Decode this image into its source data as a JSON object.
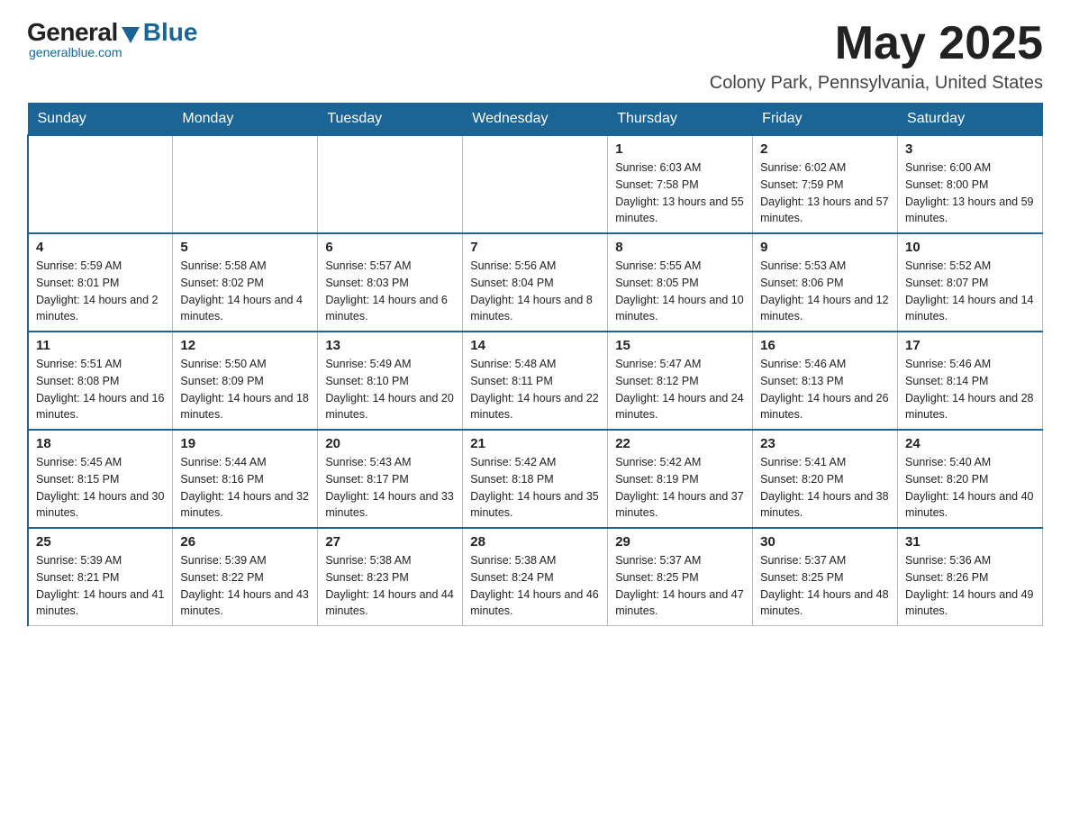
{
  "header": {
    "logo": {
      "general": "General",
      "blue": "Blue",
      "subtitle": "generalblue.com"
    },
    "title": "May 2025",
    "location": "Colony Park, Pennsylvania, United States"
  },
  "days_of_week": [
    "Sunday",
    "Monday",
    "Tuesday",
    "Wednesday",
    "Thursday",
    "Friday",
    "Saturday"
  ],
  "weeks": [
    [
      {
        "day": "",
        "info": ""
      },
      {
        "day": "",
        "info": ""
      },
      {
        "day": "",
        "info": ""
      },
      {
        "day": "",
        "info": ""
      },
      {
        "day": "1",
        "info": "Sunrise: 6:03 AM\nSunset: 7:58 PM\nDaylight: 13 hours and 55 minutes."
      },
      {
        "day": "2",
        "info": "Sunrise: 6:02 AM\nSunset: 7:59 PM\nDaylight: 13 hours and 57 minutes."
      },
      {
        "day": "3",
        "info": "Sunrise: 6:00 AM\nSunset: 8:00 PM\nDaylight: 13 hours and 59 minutes."
      }
    ],
    [
      {
        "day": "4",
        "info": "Sunrise: 5:59 AM\nSunset: 8:01 PM\nDaylight: 14 hours and 2 minutes."
      },
      {
        "day": "5",
        "info": "Sunrise: 5:58 AM\nSunset: 8:02 PM\nDaylight: 14 hours and 4 minutes."
      },
      {
        "day": "6",
        "info": "Sunrise: 5:57 AM\nSunset: 8:03 PM\nDaylight: 14 hours and 6 minutes."
      },
      {
        "day": "7",
        "info": "Sunrise: 5:56 AM\nSunset: 8:04 PM\nDaylight: 14 hours and 8 minutes."
      },
      {
        "day": "8",
        "info": "Sunrise: 5:55 AM\nSunset: 8:05 PM\nDaylight: 14 hours and 10 minutes."
      },
      {
        "day": "9",
        "info": "Sunrise: 5:53 AM\nSunset: 8:06 PM\nDaylight: 14 hours and 12 minutes."
      },
      {
        "day": "10",
        "info": "Sunrise: 5:52 AM\nSunset: 8:07 PM\nDaylight: 14 hours and 14 minutes."
      }
    ],
    [
      {
        "day": "11",
        "info": "Sunrise: 5:51 AM\nSunset: 8:08 PM\nDaylight: 14 hours and 16 minutes."
      },
      {
        "day": "12",
        "info": "Sunrise: 5:50 AM\nSunset: 8:09 PM\nDaylight: 14 hours and 18 minutes."
      },
      {
        "day": "13",
        "info": "Sunrise: 5:49 AM\nSunset: 8:10 PM\nDaylight: 14 hours and 20 minutes."
      },
      {
        "day": "14",
        "info": "Sunrise: 5:48 AM\nSunset: 8:11 PM\nDaylight: 14 hours and 22 minutes."
      },
      {
        "day": "15",
        "info": "Sunrise: 5:47 AM\nSunset: 8:12 PM\nDaylight: 14 hours and 24 minutes."
      },
      {
        "day": "16",
        "info": "Sunrise: 5:46 AM\nSunset: 8:13 PM\nDaylight: 14 hours and 26 minutes."
      },
      {
        "day": "17",
        "info": "Sunrise: 5:46 AM\nSunset: 8:14 PM\nDaylight: 14 hours and 28 minutes."
      }
    ],
    [
      {
        "day": "18",
        "info": "Sunrise: 5:45 AM\nSunset: 8:15 PM\nDaylight: 14 hours and 30 minutes."
      },
      {
        "day": "19",
        "info": "Sunrise: 5:44 AM\nSunset: 8:16 PM\nDaylight: 14 hours and 32 minutes."
      },
      {
        "day": "20",
        "info": "Sunrise: 5:43 AM\nSunset: 8:17 PM\nDaylight: 14 hours and 33 minutes."
      },
      {
        "day": "21",
        "info": "Sunrise: 5:42 AM\nSunset: 8:18 PM\nDaylight: 14 hours and 35 minutes."
      },
      {
        "day": "22",
        "info": "Sunrise: 5:42 AM\nSunset: 8:19 PM\nDaylight: 14 hours and 37 minutes."
      },
      {
        "day": "23",
        "info": "Sunrise: 5:41 AM\nSunset: 8:20 PM\nDaylight: 14 hours and 38 minutes."
      },
      {
        "day": "24",
        "info": "Sunrise: 5:40 AM\nSunset: 8:20 PM\nDaylight: 14 hours and 40 minutes."
      }
    ],
    [
      {
        "day": "25",
        "info": "Sunrise: 5:39 AM\nSunset: 8:21 PM\nDaylight: 14 hours and 41 minutes."
      },
      {
        "day": "26",
        "info": "Sunrise: 5:39 AM\nSunset: 8:22 PM\nDaylight: 14 hours and 43 minutes."
      },
      {
        "day": "27",
        "info": "Sunrise: 5:38 AM\nSunset: 8:23 PM\nDaylight: 14 hours and 44 minutes."
      },
      {
        "day": "28",
        "info": "Sunrise: 5:38 AM\nSunset: 8:24 PM\nDaylight: 14 hours and 46 minutes."
      },
      {
        "day": "29",
        "info": "Sunrise: 5:37 AM\nSunset: 8:25 PM\nDaylight: 14 hours and 47 minutes."
      },
      {
        "day": "30",
        "info": "Sunrise: 5:37 AM\nSunset: 8:25 PM\nDaylight: 14 hours and 48 minutes."
      },
      {
        "day": "31",
        "info": "Sunrise: 5:36 AM\nSunset: 8:26 PM\nDaylight: 14 hours and 49 minutes."
      }
    ]
  ]
}
